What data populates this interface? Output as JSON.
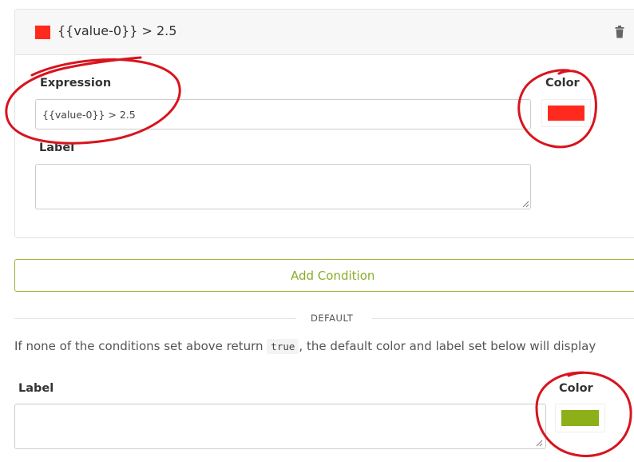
{
  "condition": {
    "title": "{{value-0}} > 2.5",
    "expression_label": "Expression",
    "expression_value": "{{value-0}} > 2.5",
    "label_label": "Label",
    "label_value": "",
    "color_label": "Color",
    "color": "#ff2a1d",
    "delete_icon": "trash-icon"
  },
  "add_condition": {
    "label": "Add Condition"
  },
  "default_section": {
    "divider": "DEFAULT",
    "help_before": "If none of the conditions set above return ",
    "help_code": "true",
    "help_after": ", the default color and label set below will display",
    "label_label": "Label",
    "label_value": "",
    "color_label": "Color",
    "color": "#8daf1a"
  },
  "annotation_color": "#d8141e"
}
